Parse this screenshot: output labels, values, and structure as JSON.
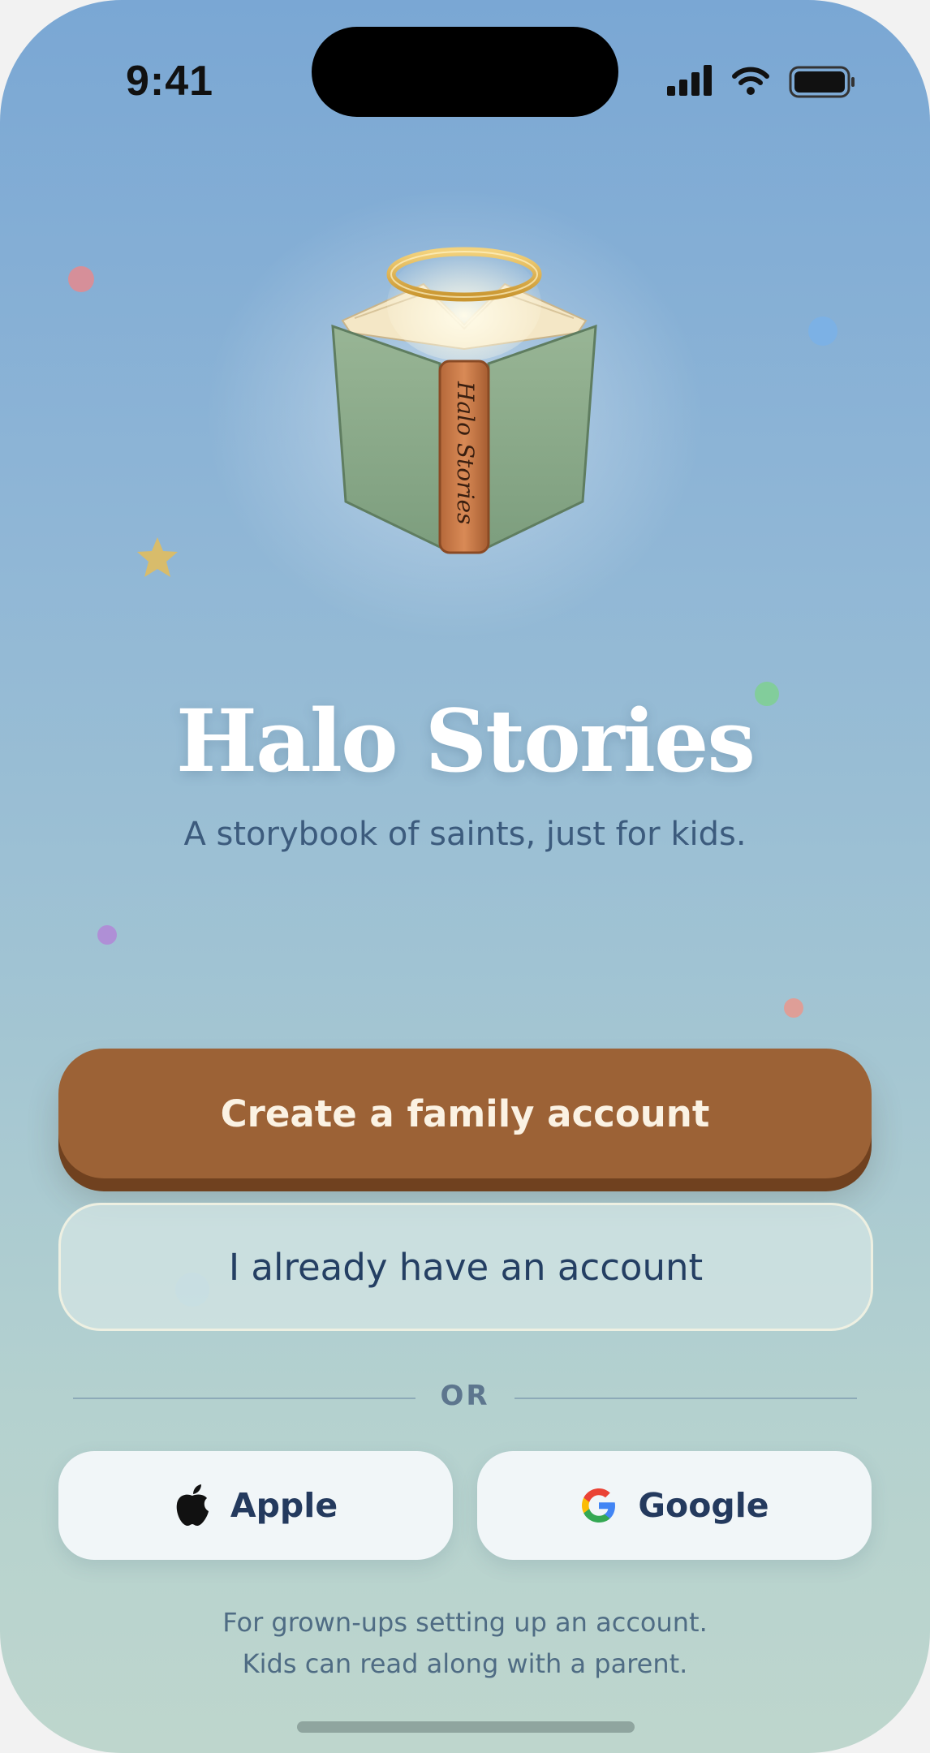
{
  "status_bar": {
    "time": "9:41"
  },
  "app": {
    "title": "Halo Stories",
    "subtitle": "A storybook of saints, just for kids.",
    "book_spine_text": "Halo Stories"
  },
  "actions": {
    "create_label": "Create a family account",
    "signin_label": "I already have an account",
    "divider_label": "OR",
    "apple_label": "Apple",
    "google_label": "Google"
  },
  "footer": {
    "line1": "For grown-ups setting up an account.",
    "line2": "Kids can read along with a parent."
  },
  "colors": {
    "primary_button": "#9c6236",
    "title_text": "#ffffff",
    "link_text": "#243f63"
  },
  "icons": [
    "signal-icon",
    "wifi-icon",
    "battery-icon",
    "apple-icon",
    "google-icon",
    "star-icon"
  ]
}
